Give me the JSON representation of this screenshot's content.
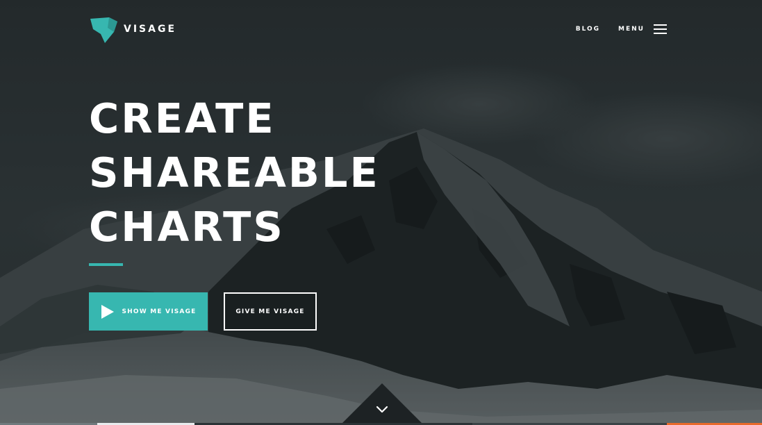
{
  "header": {
    "brand": "VISAGE",
    "logo_icon": "visage-shield-logo-icon",
    "nav": {
      "blog_label": "BLOG",
      "menu_label": "MENU",
      "menu_icon": "hamburger-menu-icon"
    }
  },
  "hero": {
    "headline_lines": [
      "CREATE",
      "SHAREABLE",
      "CHARTS"
    ],
    "primary_button": {
      "label": "SHOW ME VISAGE",
      "icon": "play-icon"
    },
    "secondary_button": {
      "label": "GIVE ME VISAGE"
    },
    "scroll_icon": "chevron-down-icon",
    "background": "snowy-mountain-photo"
  },
  "colors": {
    "accent": "#37b7b0",
    "overlay": "#242b2e",
    "text": "#ffffff",
    "scroll_tab": "#1d2224"
  }
}
